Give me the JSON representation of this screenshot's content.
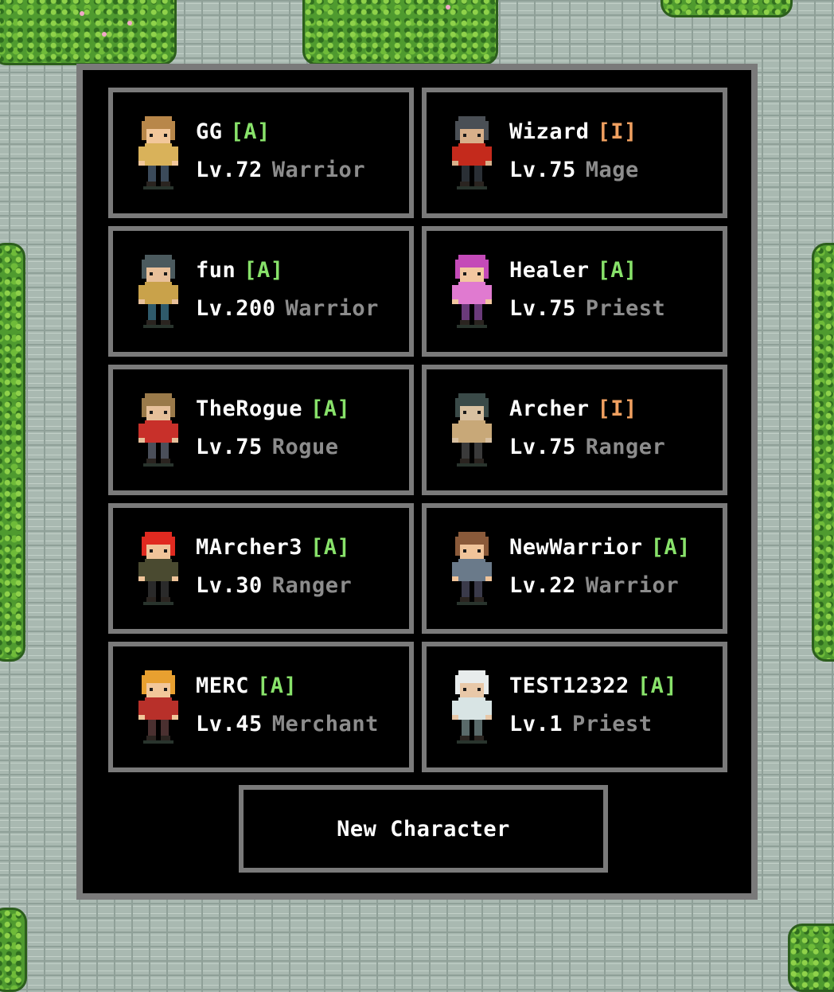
{
  "status_colors": {
    "A": "#88e26a",
    "I": "#f0a060"
  },
  "characters": [
    {
      "name": "GG",
      "status": "[A]",
      "status_code": "A",
      "level": "Lv.72",
      "class": "Warrior",
      "avatar": "warrior-spiky-hair-sprite"
    },
    {
      "name": "Wizard",
      "status": "[I]",
      "status_code": "I",
      "level": "Lv.75",
      "class": "Mage",
      "avatar": "horned-mage-sprite"
    },
    {
      "name": "fun",
      "status": "[A]",
      "status_code": "A",
      "level": "Lv.200",
      "class": "Warrior",
      "avatar": "hooded-warrior-sprite"
    },
    {
      "name": "Healer",
      "status": "[A]",
      "status_code": "A",
      "level": "Lv.75",
      "class": "Priest",
      "avatar": "pink-priest-sprite"
    },
    {
      "name": "TheRogue",
      "status": "[A]",
      "status_code": "A",
      "level": "Lv.75",
      "class": "Rogue",
      "avatar": "masked-rogue-sprite"
    },
    {
      "name": "Archer",
      "status": "[I]",
      "status_code": "I",
      "level": "Lv.75",
      "class": "Ranger",
      "avatar": "hooded-ranger-sprite"
    },
    {
      "name": "MArcher3",
      "status": "[A]",
      "status_code": "A",
      "level": "Lv.30",
      "class": "Ranger",
      "avatar": "red-hair-ranger-sprite"
    },
    {
      "name": "NewWarrior",
      "status": "[A]",
      "status_code": "A",
      "level": "Lv.22",
      "class": "Warrior",
      "avatar": "brown-hair-warrior-sprite"
    },
    {
      "name": "MERC",
      "status": "[A]",
      "status_code": "A",
      "level": "Lv.45",
      "class": "Merchant",
      "avatar": "red-cap-merchant-sprite"
    },
    {
      "name": "TEST12322",
      "status": "[A]",
      "status_code": "A",
      "level": "Lv.1",
      "class": "Priest",
      "avatar": "white-robe-priest-sprite"
    }
  ],
  "new_character_label": "New Character"
}
